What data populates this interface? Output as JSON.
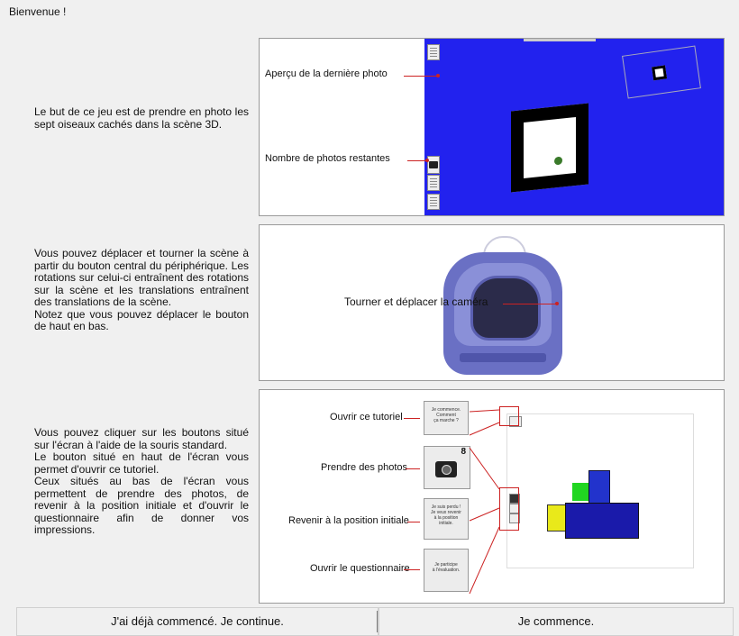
{
  "title": "Bienvenue !",
  "sections": [
    {
      "text": "Le but de ce jeu est de prendre en photo les sept oiseaux cachés dans la scène 3D."
    },
    {
      "text": "Vous pouvez déplacer et tourner la scène à partir du bouton central du périphérique. Les rotations sur celui-ci entraînent des rotations sur la scène et les translations entraînent des translations de la scène.\nNotez que vous pouvez déplacer le bouton de haut en bas."
    },
    {
      "text": "Vous pouvez cliquer sur les boutons situé sur l'écran à l'aide de la souris standard.\nLe bouton situé en haut de l'écran vous permet d'ouvrir ce tutoriel.\nCeux situés au bas de l'écran vous permettent de prendre des photos, de revenir à la position initiale et d'ouvrir le questionnaire afin de donner vos impressions."
    }
  ],
  "panel1": {
    "label_last_photo": "Aperçu de la dernière photo",
    "label_remaining": "Nombre de photos restantes"
  },
  "panel2": {
    "label_camera": "Tourner et déplacer la caméra"
  },
  "panel3": {
    "label_tutorial": "Ouvrir ce tutoriel",
    "label_photos": "Prendre des photos",
    "label_reset": "Revenir à la position initiale",
    "label_questionnaire": "Ouvrir le questionnaire",
    "box_tutorial": "Je commence.\nComment\nça marche ?",
    "photo_count": "8",
    "box_reset": "Je suis perdu !\nJe veux revenir\nà la position\ninitiale.",
    "box_questionnaire": "Je participe\nà l'évaluation."
  },
  "buttons": {
    "continue": "J'ai déjà commencé. Je continue.",
    "start": "Je commence."
  }
}
